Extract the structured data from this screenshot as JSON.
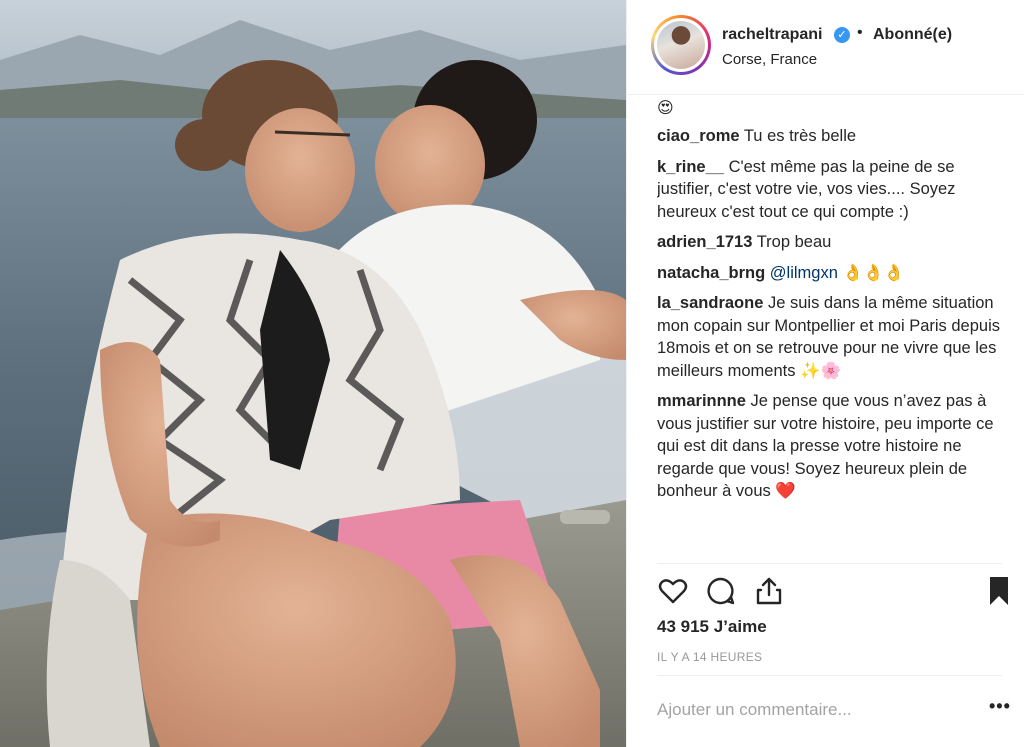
{
  "header": {
    "username": "racheltrapani",
    "verified_glyph": "✓",
    "separator": "•",
    "follow_label": "Abonné(e)",
    "location": "Corse, France"
  },
  "caption_emoji": "😍",
  "comments": [
    {
      "user": "ciao_rome",
      "text": "Tu es très belle"
    },
    {
      "user": "k_rine__",
      "text": "C'est même pas la peine de se justifier, c'est votre vie, vos vies.... Soyez heureux c'est tout ce qui compte :)"
    },
    {
      "user": "adrien_1713",
      "text": "Trop beau"
    },
    {
      "user": "natacha_brng",
      "mention": "@lilmgxn",
      "text": "👌👌👌"
    },
    {
      "user": "la_sandraone",
      "text": "Je suis dans la même situation mon copain sur Montpellier et moi Paris depuis 18mois et on se retrouve pour ne vivre que les meilleurs moments ✨🌸"
    },
    {
      "user": "mmarinnne",
      "text": "Je pense que vous n’avez pas à vous justifier sur votre histoire, peu importe ce qui est dit dans la presse votre histoire ne regarde que vous! Soyez heureux plein de bonheur à vous ❤️"
    }
  ],
  "likes": "43 915 J’aime",
  "timestamp": "IL Y A 14 HEURES",
  "add_comment": {
    "placeholder": "Ajouter un commentaire..."
  },
  "more_label": "•••",
  "icons": {
    "like": "heart-icon",
    "comment": "comment-bubble-icon",
    "share": "share-icon",
    "save": "bookmark-icon"
  },
  "colors": {
    "verified": "#3897f0",
    "text": "#262626",
    "muted": "#999999",
    "mention": "#003569",
    "divider": "#efefef"
  }
}
